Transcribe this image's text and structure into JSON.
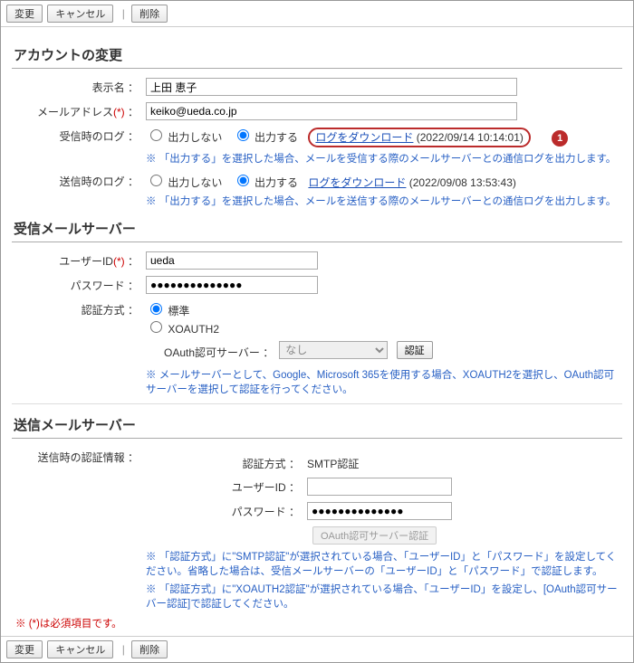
{
  "toolbar": {
    "save": "変更",
    "cancel": "キャンセル",
    "delete": "削除"
  },
  "section_account": "アカウントの変更",
  "labels": {
    "display_name": "表示名",
    "mail_address": "メールアドレス",
    "recv_log": "受信時のログ",
    "send_log": "送信時のログ",
    "user_id": "ユーザーID",
    "password": "パスワード",
    "auth_method": "認証方式",
    "oauth_server": "OAuth認可サーバー",
    "send_auth_info": "送信時の認証情報",
    "req_mark": "(*)",
    "colon": "："
  },
  "account": {
    "display_name": "上田 恵子",
    "mail_address": "keiko@ueda.co.jp"
  },
  "radio": {
    "no_output": "出力しない",
    "output": "出力する"
  },
  "log": {
    "download": "ログをダウンロード",
    "recv_ts": "(2022/09/14 10:14:01)",
    "send_ts": "(2022/09/08 13:53:43)",
    "recv_hint": "※ 「出力する」を選択した場合、メールを受信する際のメールサーバーとの通信ログを出力します。",
    "send_hint": "※ 「出力する」を選択した場合、メールを送信する際のメールサーバーとの通信ログを出力します。"
  },
  "callout1": "1",
  "section_recv": "受信メールサーバー",
  "recv": {
    "user_id": "ueda",
    "password": "●●●●●●●●●●●●●●",
    "auth_std": "標準",
    "auth_xoauth2": "XOAUTH2",
    "oauth_none": "なし",
    "oauth_btn": "認証",
    "hint": "※ メールサーバーとして、Google、Microsoft 365を使用する場合、XOAUTH2を選択し、OAuth認可サーバーを選択して認証を行ってください。"
  },
  "section_send": "送信メールサーバー",
  "send": {
    "auth_method_value": "SMTP認証",
    "user_id": "",
    "password": "●●●●●●●●●●●●●●",
    "oauth_btn": "OAuth認可サーバー認証",
    "hint1": "※ 「認証方式」に\"SMTP認証\"が選択されている場合、「ユーザーID」と「パスワード」を設定してください。省略した場合は、受信メールサーバーの「ユーザーID」と「パスワード」で認証します。",
    "hint2": "※ 「認証方式」に\"XOAUTH2認証\"が選択されている場合、「ユーザーID」を設定し、[OAuth認可サーバー認証]で認証してください。"
  },
  "footnote": "※ (*)は必須項目です。"
}
